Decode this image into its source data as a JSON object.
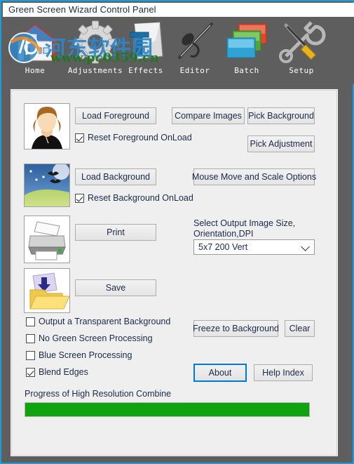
{
  "window": {
    "title": "Green Screen Wizard Control Panel",
    "accent_color": "#1e9ad6",
    "toolbar_bg": "#5e5e5e",
    "panel_bg": "#efefef"
  },
  "toolbar": {
    "items": [
      {
        "label": "Home",
        "icon": "home-icon"
      },
      {
        "label": "Adjustments",
        "icon": "gear-icon"
      },
      {
        "label": "Effects",
        "icon": "effects-folder-icon"
      },
      {
        "label": "Editor",
        "icon": "airbrush-icon"
      },
      {
        "label": "Batch",
        "icon": "stacked-images-icon"
      },
      {
        "label": "Setup",
        "icon": "wrench-screwdriver-icon"
      }
    ]
  },
  "watermark": {
    "chinese": "河东软件园",
    "url": "www.pc0359.cn"
  },
  "foreground": {
    "thumbnail_name": "portrait-thumbnail",
    "load_button": "Load Foreground",
    "reset_checkbox": "Reset Foreground OnLoad",
    "reset_checked": true
  },
  "background": {
    "thumbnail_name": "landscape-thumbnail",
    "load_button": "Load Background",
    "reset_checkbox": "Reset Background OnLoad",
    "reset_checked": true
  },
  "print": {
    "thumbnail_name": "printer-thumbnail",
    "button": "Print"
  },
  "save": {
    "thumbnail_name": "save-folder-thumbnail",
    "button": "Save"
  },
  "right_actions": {
    "compare_images": "Compare Images",
    "pick_background": "Pick Background",
    "pick_adjustment": "Pick Adjustment",
    "mouse_move_scale": "Mouse Move and Scale Options",
    "freeze_to_background": "Freeze to Background",
    "clear": "Clear",
    "about": "About",
    "help_index": "Help Index"
  },
  "output_size": {
    "label": "Select Output Image Size,\nOrientation,DPI",
    "selected": "5x7 200 Vert",
    "options": [
      "5x7 200 Vert"
    ]
  },
  "options": {
    "items": [
      {
        "label": "Output a Transparent Background",
        "checked": false
      },
      {
        "label": "No Green Screen Processing",
        "checked": false
      },
      {
        "label": "Blue Screen Processing",
        "checked": false
      },
      {
        "label": "Blend Edges",
        "checked": true
      }
    ]
  },
  "progress": {
    "label": "Progress of High Resolution Combine",
    "percent": 100,
    "bar_color": "#10A310"
  }
}
